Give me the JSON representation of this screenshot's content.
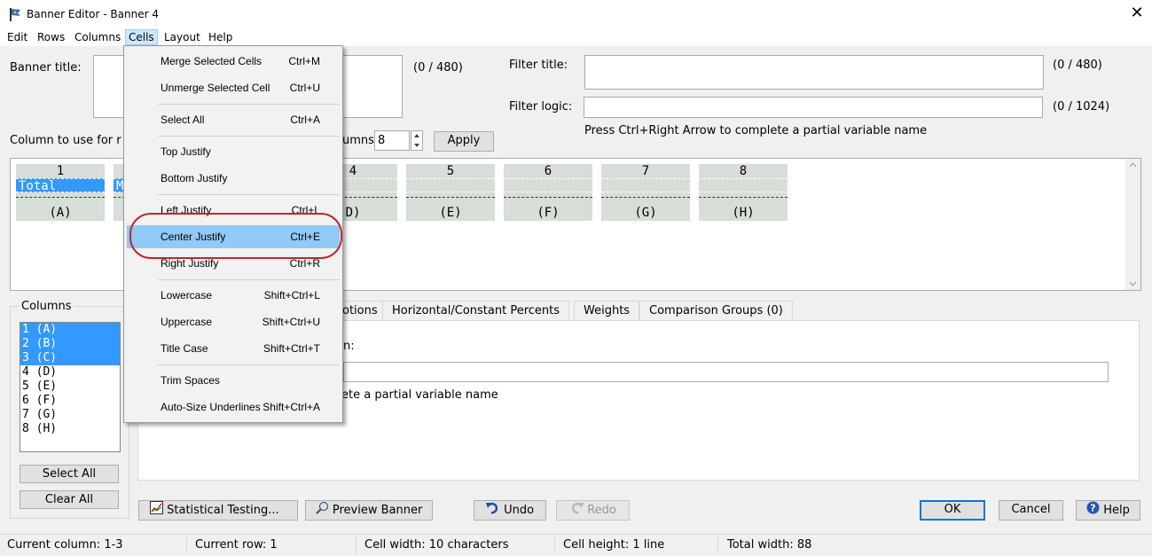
{
  "window": {
    "title": "Banner Editor - Banner 4",
    "close_glyph": "✕"
  },
  "menubar": [
    "Edit",
    "Rows",
    "Columns",
    "Cells",
    "Layout",
    "Help"
  ],
  "banner_title": {
    "label": "Banner title:",
    "counter": "(0 / 480)"
  },
  "filter_title": {
    "label": "Filter title:",
    "counter": "(0 / 480)"
  },
  "filter_logic": {
    "label": "Filter logic:",
    "counter": "(0 / 1024)",
    "hint": "Press Ctrl+Right Arrow to complete a partial variable name"
  },
  "column_use": {
    "label_part": "Column to use for r",
    "columns_label": "umns",
    "columns_value": "8",
    "apply_label": "Apply"
  },
  "grid_columns": [
    {
      "num": "1",
      "text": "Total",
      "letter": "(A)",
      "selected": true
    },
    {
      "num": "",
      "text": "M",
      "letter": "",
      "selected": true
    },
    {
      "num": "4",
      "text": "",
      "letter": "D)"
    },
    {
      "num": "5",
      "text": "",
      "letter": "(E)"
    },
    {
      "num": "6",
      "text": "",
      "letter": "(F)"
    },
    {
      "num": "7",
      "text": "",
      "letter": "(G)"
    },
    {
      "num": "8",
      "text": "",
      "letter": "(H)"
    }
  ],
  "columns_group": {
    "label": "Columns",
    "items": [
      "1 (A)",
      "2 (B)",
      "3 (C)",
      "4 (D)",
      "5 (E)",
      "6 (F)",
      "7 (G)",
      "8 (H)"
    ],
    "selected_count": 3,
    "select_all": "Select All",
    "clear_all": "Clear All"
  },
  "tabs": [
    "otions",
    "Horizontal/Constant Percents",
    "Weights",
    "Comparison Groups (0)"
  ],
  "panel": {
    "label_tail": "n:",
    "hint_tail": "ete a partial variable name"
  },
  "buttons": {
    "stat_testing": "Statistical Testing...",
    "preview": "Preview Banner",
    "undo": "Undo",
    "redo": "Redo",
    "ok": "OK",
    "cancel": "Cancel",
    "help": "Help"
  },
  "status": {
    "col": "Current column: 1-3",
    "row": "Current row: 1",
    "width": "Cell width: 10 characters",
    "height": "Cell height: 1 line",
    "total": "Total width: 88"
  },
  "cells_menu": [
    {
      "label": "Merge Selected Cells",
      "shortcut": "Ctrl+M"
    },
    {
      "label": "Unmerge Selected Cell",
      "shortcut": "Ctrl+U"
    },
    {
      "label": "Select All",
      "shortcut": "Ctrl+A"
    },
    {
      "label": "Top Justify",
      "shortcut": ""
    },
    {
      "label": "Bottom Justify",
      "shortcut": ""
    },
    {
      "label": "Left Justify",
      "shortcut": "Ctrl+L"
    },
    {
      "label": "Center Justify",
      "shortcut": "Ctrl+E",
      "highlighted": true
    },
    {
      "label": "Right Justify",
      "shortcut": "Ctrl+R"
    },
    {
      "label": "Lowercase",
      "shortcut": "Shift+Ctrl+L"
    },
    {
      "label": "Uppercase",
      "shortcut": "Shift+Ctrl+U"
    },
    {
      "label": "Title Case",
      "shortcut": "Shift+Ctrl+T"
    },
    {
      "label": "Trim Spaces",
      "shortcut": ""
    },
    {
      "label": "Auto-Size Underlines",
      "shortcut": "Shift+Ctrl+A"
    }
  ],
  "colors": {
    "selection": "#3399ff",
    "menu_highlight": "#91c9f7",
    "annotation_ring": "#c0272d",
    "cell_bg": "#d7ddd7"
  }
}
